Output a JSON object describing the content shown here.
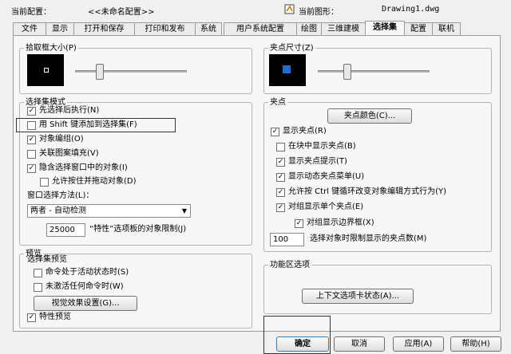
{
  "header": {
    "profile_label": "当前配置：",
    "profile_value": "<<未命名配置>>",
    "drawing_label": "当前图形：",
    "drawing_value": "Drawing1.dwg"
  },
  "tabs": [
    "文件",
    "显示",
    "打开和保存",
    "打印和发布",
    "系统",
    "用户系统配置",
    "绘图",
    "三维建模",
    "选择集",
    "配置",
    "联机"
  ],
  "active_tab": "选择集",
  "pickbox": {
    "title": "拾取框大小(P)",
    "level": 0.35
  },
  "grip_size": {
    "title": "夹点尺寸(Z)",
    "level": 0.1
  },
  "selection_modes": {
    "title": "选择集模式",
    "options": [
      {
        "label": "先选择后执行(N)",
        "checked": true
      },
      {
        "label": "用 Shift 键添加到选择集(F)",
        "checked": false
      },
      {
        "label": "对象编组(O)",
        "checked": true
      },
      {
        "label": "关联图案填充(V)",
        "checked": false
      },
      {
        "label": "隐含选择窗口中的对象(I)",
        "checked": true
      },
      {
        "label": "允许按住并拖动对象(D)",
        "checked": false
      }
    ],
    "window_method_label": "窗口选择方法(L)：",
    "window_method_value": "两者 - 自动检测",
    "limit_value": "25000",
    "limit_label": "“特性”选项板的对象限制(J)"
  },
  "preview": {
    "title": "预览",
    "sub_title": "选择集预览",
    "options": [
      {
        "label": "命令处于活动状态时(S)",
        "checked": false
      },
      {
        "label": "未激活任何命令时(W)",
        "checked": false
      }
    ],
    "visual_button": "视觉效果设置(G)...",
    "property_preview": {
      "label": "特性预览",
      "checked": true
    }
  },
  "grips": {
    "title": "夹点",
    "color_button": "夹点颜色(C)...",
    "options": [
      {
        "label": "显示夹点(R)",
        "checked": true
      },
      {
        "label": "在块中显示夹点(B)",
        "checked": false
      },
      {
        "label": "显示夹点提示(T)",
        "checked": true
      },
      {
        "label": "显示动态夹点菜单(U)",
        "checked": true
      },
      {
        "label": "允许按 Ctrl 键循环改变对象编辑方式行为(Y)",
        "checked": true
      },
      {
        "label": "对组显示单个夹点(E)",
        "checked": true
      },
      {
        "label": "对组显示边界框(X)",
        "checked": true
      }
    ],
    "limit_value": "100",
    "limit_label": "选择对象时限制显示的夹点数(M)"
  },
  "ribbon": {
    "title": "功能区选项",
    "button": "上下文选项卡状态(A)..."
  },
  "footer": {
    "ok": "确定",
    "cancel": "取消",
    "apply": "应用(A)",
    "help": "帮助(H)"
  }
}
